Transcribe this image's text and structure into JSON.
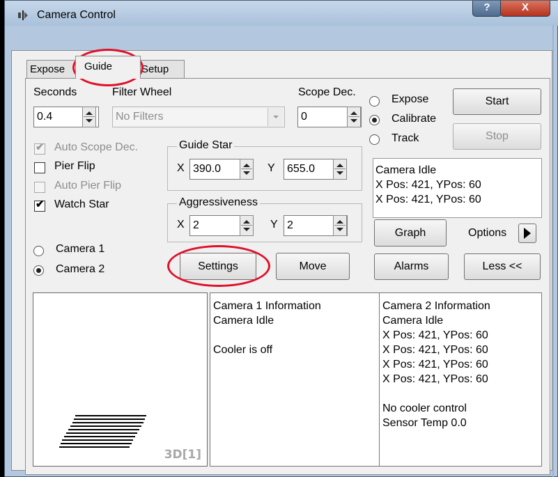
{
  "window": {
    "title": "Camera Control",
    "help_label": "?",
    "close_label": "X"
  },
  "tabs": [
    {
      "label": "Expose"
    },
    {
      "label": "Guide"
    },
    {
      "label": "Setup"
    }
  ],
  "seconds": {
    "label": "Seconds",
    "value": "0.4"
  },
  "filter_wheel": {
    "label": "Filter Wheel",
    "value": "No Filters"
  },
  "scope_dec": {
    "label": "Scope Dec.",
    "value": "0"
  },
  "mode": {
    "options": [
      {
        "label": "Expose",
        "selected": false
      },
      {
        "label": "Calibrate",
        "selected": true
      },
      {
        "label": "Track",
        "selected": false
      }
    ]
  },
  "buttons": {
    "start": "Start",
    "stop": "Stop",
    "graph": "Graph",
    "options": "Options",
    "settings": "Settings",
    "move": "Move",
    "alarms": "Alarms",
    "less": "Less <<"
  },
  "checkboxes": [
    {
      "label": "Auto Scope Dec.",
      "checked": true,
      "enabled": false
    },
    {
      "label": "Pier Flip",
      "checked": false,
      "enabled": true
    },
    {
      "label": "Auto Pier Flip",
      "checked": false,
      "enabled": false
    },
    {
      "label": "Watch Star",
      "checked": true,
      "enabled": true
    }
  ],
  "guide_star": {
    "label": "Guide Star",
    "x_label": "X",
    "x_value": "390.0",
    "y_label": "Y",
    "y_value": "655.0"
  },
  "aggressiveness": {
    "label": "Aggressiveness",
    "x_label": "X",
    "x_value": "2",
    "y_label": "Y",
    "y_value": "2"
  },
  "status_box": {
    "lines": [
      "Camera Idle",
      "X Pos: 421, YPos: 60",
      "X Pos: 421, YPos: 60"
    ]
  },
  "camera_select": [
    {
      "label": "Camera 1",
      "selected": false
    },
    {
      "label": "Camera 2",
      "selected": true
    }
  ],
  "preview": {
    "label": "3D[1]"
  },
  "camera1_info": {
    "lines": [
      "Camera 1 Information",
      "Camera Idle",
      "",
      "Cooler is off"
    ]
  },
  "camera2_info": {
    "lines": [
      "Camera 2 Information",
      "Camera Idle",
      "X Pos: 421, YPos: 60",
      "X Pos: 421, YPos: 60",
      "X Pos: 421, YPos: 60",
      "X Pos: 421, YPos: 60",
      "",
      "No cooler control",
      "Sensor Temp 0.0"
    ]
  },
  "colors": {
    "annotation": "#e0102a",
    "titlebar": "#b3c8df",
    "close": "#c7432b"
  }
}
